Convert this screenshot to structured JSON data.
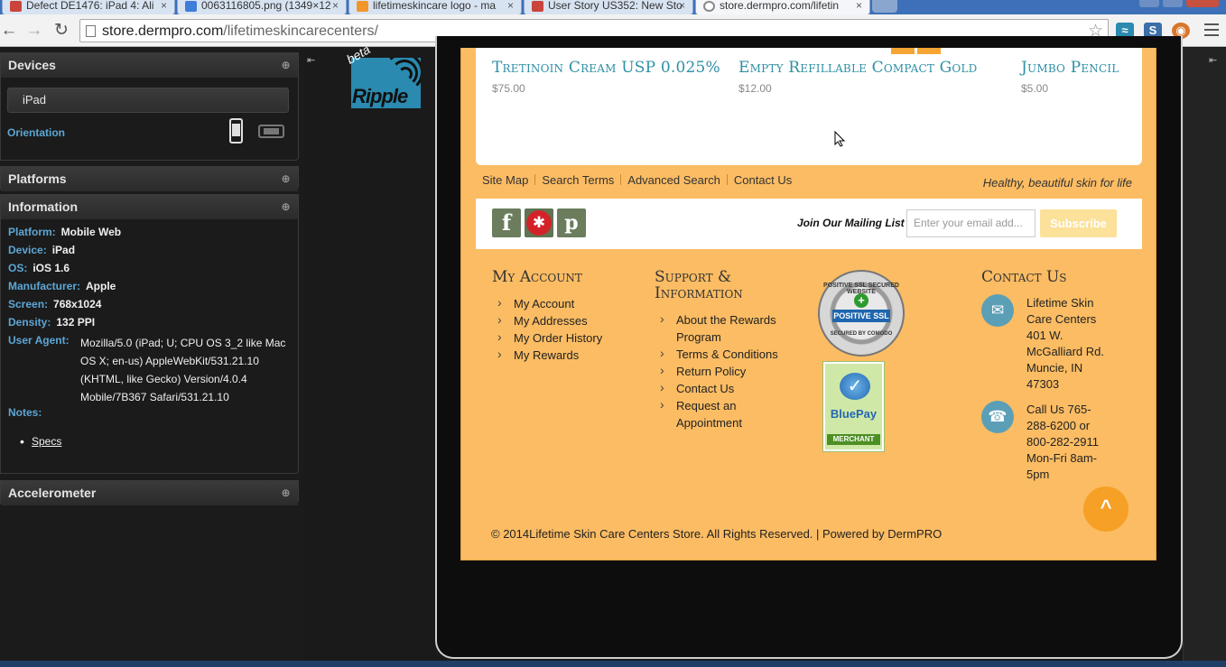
{
  "browser": {
    "tabs": [
      {
        "title": "Defect DE1476: iPad 4: Ali",
        "favicon_color": "#c9453b"
      },
      {
        "title": "0063116805.png (1349×12",
        "favicon_color": "#3d7ed8"
      },
      {
        "title": "lifetimeskincare logo - ma",
        "favicon_color": "#f0962a"
      },
      {
        "title": "User Story US352: New Sto",
        "favicon_color": "#c9453b"
      },
      {
        "title": "store.dermpro.com/lifetin",
        "favicon_color": "#ffffff"
      }
    ],
    "close_glyph": "×",
    "url_host": "store.dermpro.com",
    "url_path": "/lifetimeskincarecenters/",
    "back_glyph": "←",
    "forward_glyph": "→",
    "reload_glyph": "↻",
    "star_glyph": "☆",
    "extensions": [
      {
        "name": "ripple-extension-icon",
        "glyph": "≈",
        "color": "#2a8ab0"
      },
      {
        "name": "s-extension-icon",
        "glyph": "S",
        "color": "#3a6fa8"
      },
      {
        "name": "color-extension-icon",
        "glyph": "◉",
        "color": "#d9762b"
      }
    ]
  },
  "ripple": {
    "devices_title": "Devices",
    "device_selected": "iPad",
    "orientation_label": "Orientation",
    "platforms_title": "Platforms",
    "information_title": "Information",
    "expand_glyph": "⊕",
    "info": [
      {
        "key": "Platform:",
        "value": "Mobile Web"
      },
      {
        "key": "Device:",
        "value": "iPad"
      },
      {
        "key": "OS:",
        "value": "iOS 1.6"
      },
      {
        "key": "Manufacturer:",
        "value": "Apple"
      },
      {
        "key": "Screen:",
        "value": "768x1024"
      },
      {
        "key": "Density:",
        "value": "132 PPI"
      }
    ],
    "user_agent_label": "User Agent:",
    "user_agent_value": "Mozilla/5.0 (iPad; U; CPU OS 3_2 like Mac OS X; en-us) AppleWebKit/531.21.10 (KHTML, like Gecko) Version/4.0.4 Mobile/7B367 Safari/531.21.10",
    "notes_label": "Notes:",
    "notes_link": "Specs",
    "accelerometer_title": "Accelerometer",
    "collapse_glyph": "⇤",
    "logo_text": "Ripple",
    "beta_text": "beta"
  },
  "site": {
    "products": [
      {
        "name": "Tretinoin Cream USP 0.025%",
        "price": "$75.00"
      },
      {
        "name": "Empty Refillable Compact Gold",
        "price": "$12.00"
      },
      {
        "name": "Jumbo Pencil",
        "price": "$5.00"
      }
    ],
    "footer_links": [
      "Site Map",
      "Search Terms",
      "Advanced Search",
      "Contact Us"
    ],
    "tagline": "Healthy, beautiful skin for life",
    "social": {
      "facebook": "f",
      "yelp": "✱",
      "pinterest": "p"
    },
    "mailing_label": "Join Our Mailing List",
    "email_placeholder": "Enter your email add...",
    "subscribe_label": "Subscribe",
    "my_account": {
      "title": "My Account",
      "items": [
        "My Account",
        "My Addresses",
        "My Order History",
        "My Rewards"
      ]
    },
    "support": {
      "title_line1": "Support &",
      "title_line2": "Information",
      "items": [
        "About the Rewards Program",
        "Terms & Conditions",
        "Return Policy",
        "Contact Us",
        "Request an Appointment"
      ]
    },
    "badges": {
      "ssl_top": "POSITIVE SSL SECURED WEBSITE",
      "ssl_text": "POSITIVE SSL",
      "ssl_bottom": "SECURED BY COMODO",
      "ssl_check": "+",
      "bluepay_name": "BluePay",
      "bluepay_sub": "MERCHANT",
      "bluepay_glyph": "✓"
    },
    "contact": {
      "title": "Contact Us",
      "mail_glyph": "✉",
      "phone_glyph": "☎",
      "address": "Lifetime Skin Care Centers 401 W. McGalliard Rd. Muncie, IN 47303",
      "phone": "Call Us 765-288-6200 or 800-282-2911 Mon-Fri 8am-5pm"
    },
    "to_top_glyph": "^",
    "copyright": "© 2014Lifetime Skin Care Centers Store. All Rights Reserved. | Powered by DermPRO"
  },
  "colors": {
    "site_background": "#fbbc63",
    "product_title": "#2e8fa6",
    "ripple_label": "#5da7d6",
    "to_top": "#f6a026"
  }
}
